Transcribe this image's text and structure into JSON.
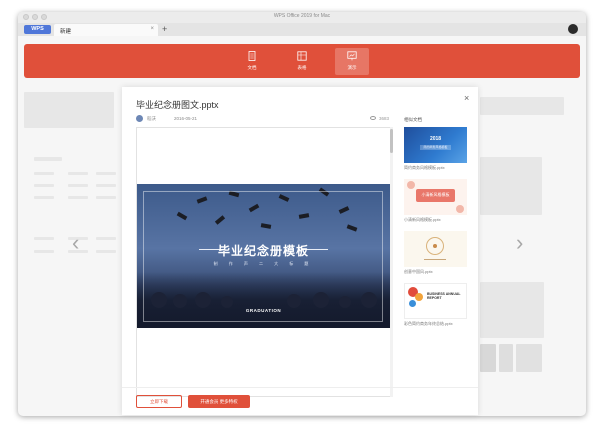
{
  "window": {
    "title": "WPS Office 2019 for Mac"
  },
  "tabbar": {
    "wps_label": "WPS",
    "tab_label": "新建",
    "close_glyph": "×",
    "add_glyph": "+"
  },
  "toolbar": {
    "items": [
      {
        "label": "文档",
        "icon": "document-icon",
        "active": false
      },
      {
        "label": "表格",
        "icon": "spreadsheet-icon",
        "active": false
      },
      {
        "label": "演示",
        "icon": "presentation-icon",
        "active": true
      }
    ]
  },
  "background": {
    "left_arrow": "‹",
    "right_arrow": "›"
  },
  "modal": {
    "title": "毕业纪念册图文.pptx",
    "author": "稻沃",
    "date": "2016-05-21",
    "views": "3683",
    "close_glyph": "×",
    "slide": {
      "title": "毕业纪念册模板",
      "subtitle": "制 作 声 二 大 标 题",
      "footer": "GRADUATION"
    },
    "related": {
      "heading": "相似文档",
      "items": [
        {
          "name": "简约商务风格模板.pptx",
          "thumb_text": "2018",
          "thumb_sub": "简约商务风格模板"
        },
        {
          "name": "小清新风格模板.pptx",
          "thumb_text": "小清新风格模板",
          "thumb_sub": ""
        },
        {
          "name": "创意中国风.pptx",
          "thumb_text": "",
          "thumb_sub": ""
        },
        {
          "name": "彩色简约商务年终总结.pptx",
          "thumb_text": "BUSINESS ANNUAL REPORT",
          "thumb_sub": ""
        }
      ]
    },
    "buttons": {
      "download": "立即下载",
      "vip": "开通会员 更多特权"
    }
  },
  "colors": {
    "accent": "#e0503a",
    "wps_blue": "#4f77d9"
  }
}
